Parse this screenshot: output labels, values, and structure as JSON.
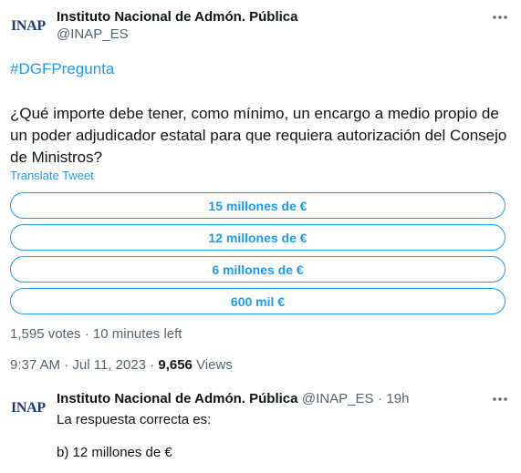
{
  "tweet": {
    "avatar_text": "INAP",
    "author_name": "Instituto Nacional de Admón. Pública",
    "author_handle": "@INAP_ES",
    "hashtag": "#DGFPregunta",
    "text": "¿Qué importe debe tener, como mínimo, un encargo a medio propio de un poder adjudicador estatal para que requiera autorización del Consejo de Ministros?",
    "translate_label": "Translate Tweet",
    "poll_options": [
      "15 millones de €",
      "12 millones de €",
      "6 millones de €",
      "600 mil €"
    ],
    "votes": "1,595 votes",
    "separator": "·",
    "time_left": "10 minutes left",
    "time": "9:37 AM",
    "date": "Jul 11, 2023",
    "views_count": "9,656",
    "views_label": "Views"
  },
  "reply": {
    "avatar_text": "INAP",
    "author_name": "Instituto Nacional de Admón. Pública",
    "author_handle": "@INAP_ES",
    "separator": "·",
    "time_ago": "19h",
    "line1": "La respuesta correcta es:",
    "line2": "b) 12 millones de €"
  },
  "colors": {
    "accent": "#1d9bf0",
    "text": "#0f1419",
    "secondary": "#536471",
    "logo": "#1a3a7a"
  },
  "icons": [
    "more-horizontal-icon"
  ]
}
